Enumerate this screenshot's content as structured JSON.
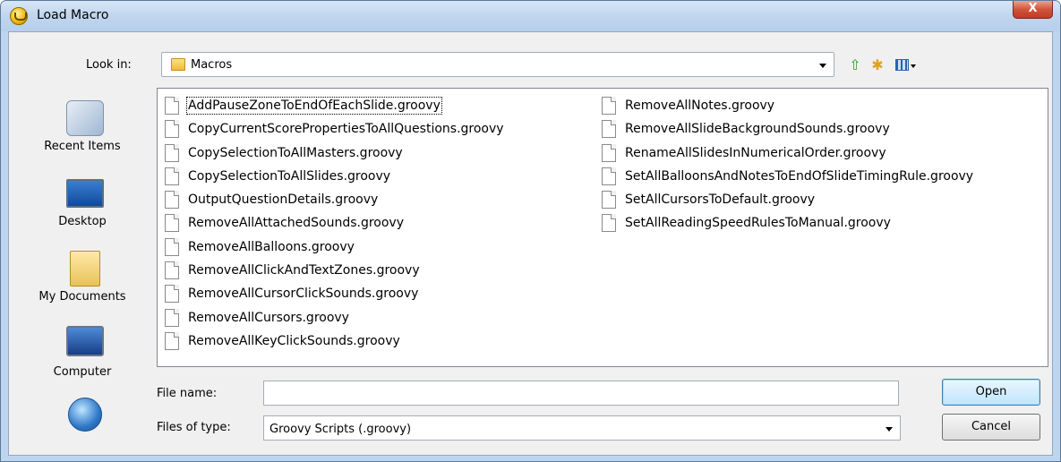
{
  "window": {
    "title": "Load Macro",
    "close_glyph": "X"
  },
  "toolbar": {
    "look_in_label": "Look in:",
    "look_in_value": "Macros",
    "icons": [
      "up-one-level-icon",
      "new-folder-icon",
      "view-menu-icon"
    ]
  },
  "places": [
    {
      "label": "Recent Items",
      "icon": "recent-items-icon"
    },
    {
      "label": "Desktop",
      "icon": "desktop-icon"
    },
    {
      "label": "My Documents",
      "icon": "my-documents-icon"
    },
    {
      "label": "Computer",
      "icon": "computer-icon"
    },
    {
      "label": "",
      "icon": "network-icon"
    }
  ],
  "files": {
    "column1": [
      "AddPauseZoneToEndOfEachSlide.groovy",
      "CopyCurrentScorePropertiesToAllQuestions.groovy",
      "CopySelectionToAllMasters.groovy",
      "CopySelectionToAllSlides.groovy",
      "OutputQuestionDetails.groovy",
      "RemoveAllAttachedSounds.groovy",
      "RemoveAllBalloons.groovy",
      "RemoveAllClickAndTextZones.groovy",
      "RemoveAllCursorClickSounds.groovy",
      "RemoveAllCursors.groovy",
      "RemoveAllKeyClickSounds.groovy"
    ],
    "column2": [
      "RemoveAllNotes.groovy",
      "RemoveAllSlideBackgroundSounds.groovy",
      "RenameAllSlidesInNumericalOrder.groovy",
      "SetAllBalloonsAndNotesToEndOfSlideTimingRule.groovy",
      "SetAllCursorsToDefault.groovy",
      "SetAllReadingSpeedRulesToManual.groovy"
    ]
  },
  "form": {
    "file_name_label": "File name:",
    "file_name_value": "",
    "files_of_type_label": "Files of type:",
    "files_of_type_value": "Groovy Scripts (.groovy)"
  },
  "buttons": {
    "open": "Open",
    "cancel": "Cancel"
  }
}
